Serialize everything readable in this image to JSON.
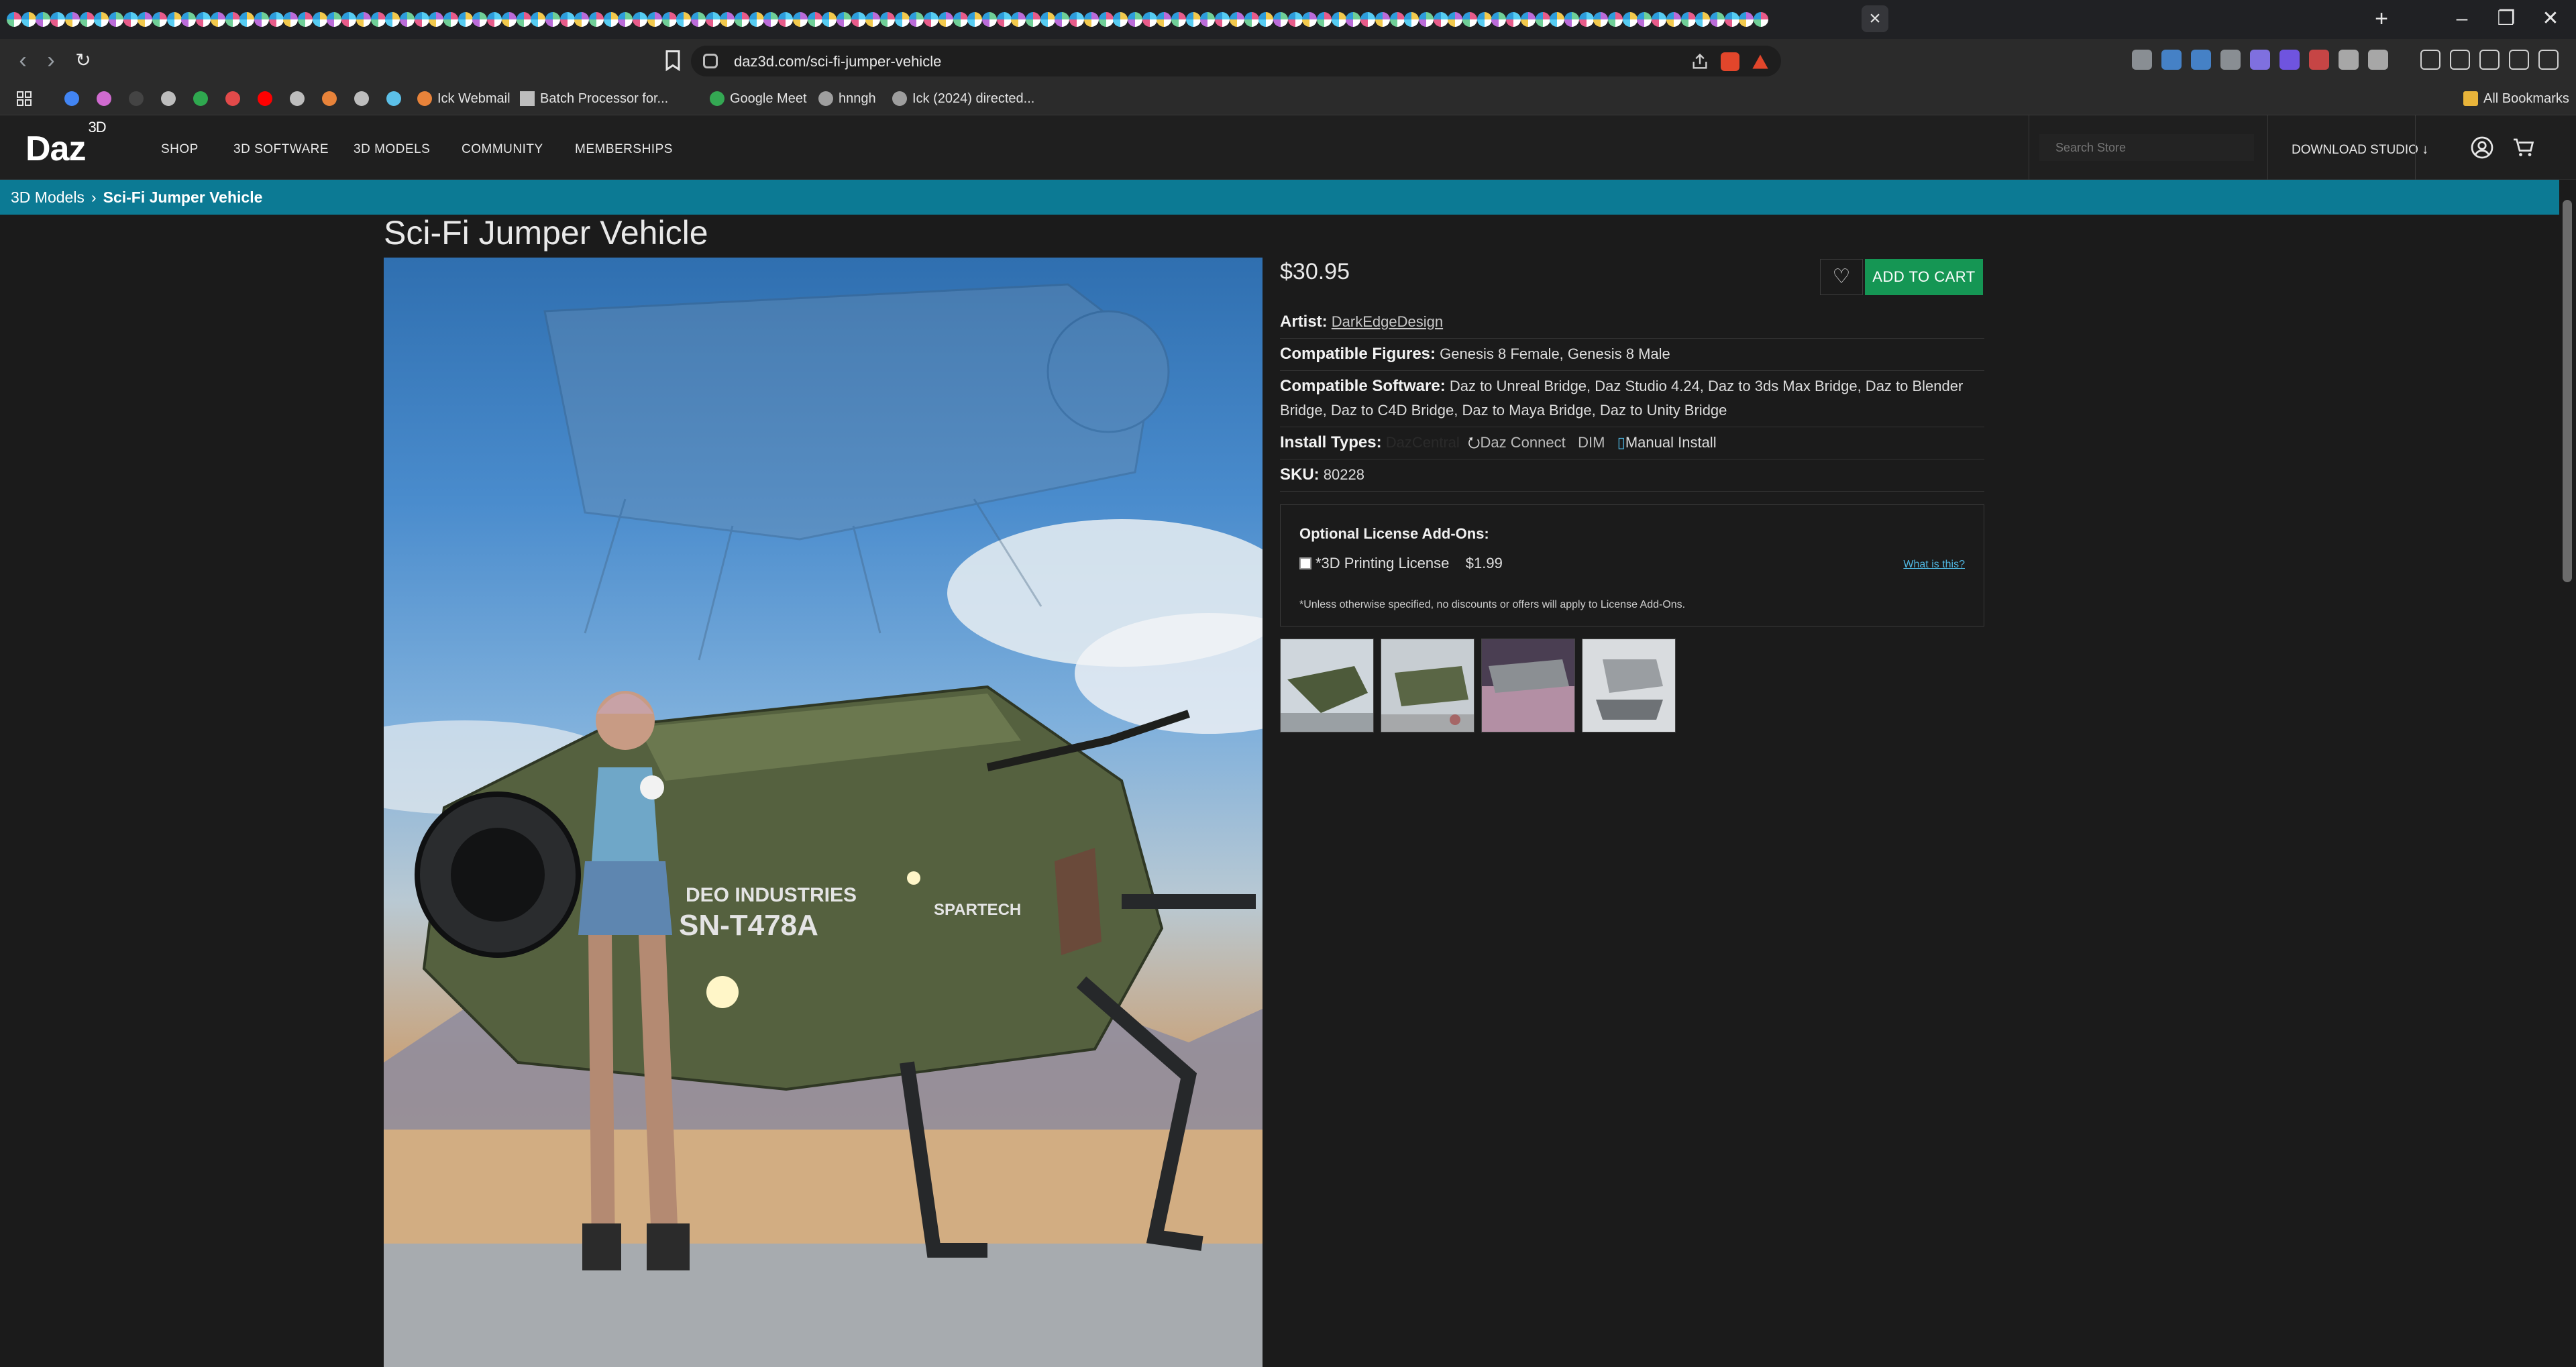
{
  "browser": {
    "url": "daz3d.com/sci-fi-jumper-vehicle",
    "tab_close_glyph": "×",
    "new_tab_glyph": "+",
    "bookmarks": [
      {
        "label": "Ick Webmail"
      },
      {
        "label": "Batch Processor for..."
      },
      {
        "label": "Google Meet"
      },
      {
        "label": "hnngh"
      },
      {
        "label": "Ick (2024) directed..."
      }
    ],
    "all_bookmarks": "All Bookmarks"
  },
  "site": {
    "logo": "Daz",
    "logo_sup": "3D",
    "nav": [
      "SHOP",
      "3D SOFTWARE",
      "3D MODELS",
      "COMMUNITY",
      "MEMBERSHIPS"
    ],
    "search_placeholder": "Search Store",
    "download_studio": "DOWNLOAD STUDIO"
  },
  "breadcrumb": {
    "parent": "3D Models",
    "separator": "›",
    "current": "Sci-Fi Jumper Vehicle"
  },
  "product": {
    "title": "Sci-Fi Jumper Vehicle",
    "price": "$30.95",
    "add_to_cart": "ADD TO CART",
    "artist_label": "Artist:",
    "artist": "DarkEdgeDesign",
    "figures_label": "Compatible Figures:",
    "figures": "Genesis 8 Female, Genesis 8 Male",
    "software_label": "Compatible Software:",
    "software": "Daz to Unreal Bridge, Daz Studio 4.24, Daz to 3ds Max Bridge, Daz to Blender Bridge, Daz to C4D Bridge, Daz to Maya Bridge, Daz to Unity Bridge",
    "install_label": "Install Types:",
    "install_dazcentral": "DazCentral",
    "install_connect": "Daz Connect",
    "install_dim": "DIM",
    "install_manual": "Manual Install",
    "sku_label": "SKU:",
    "sku": "80228",
    "hero_text_1": "DEO INDUSTRIES",
    "hero_text_2": "SN-T478A",
    "hero_text_3": "SPARTECH"
  },
  "license": {
    "title": "Optional License Add-Ons:",
    "item": "*3D Printing License",
    "price": "$1.99",
    "what_is": "What is this?",
    "note": "*Unless otherwise specified, no discounts or offers will apply to License Add-Ons."
  },
  "colors": {
    "breadcrumb_bg": "#0c7a94",
    "cart_button": "#159654",
    "link_blue": "#4fb6e0"
  }
}
